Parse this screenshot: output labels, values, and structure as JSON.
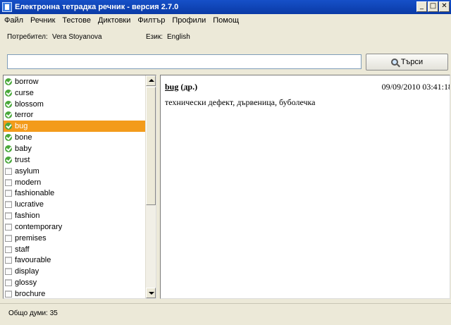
{
  "window": {
    "title": "Електронна тетрадка речник - версия 2.7.0",
    "controls": {
      "minimize": "_",
      "maximize": "□",
      "close": "✕"
    }
  },
  "menu": [
    "Файл",
    "Речник",
    "Тестове",
    "Диктовки",
    "Филтър",
    "Профили",
    "Помощ"
  ],
  "info": {
    "user_label": "Потребител:",
    "user_value": "Vera Stoyanova",
    "lang_label": "Език:",
    "lang_value": "English"
  },
  "search": {
    "value": "",
    "placeholder": "",
    "button_label": "Търси",
    "button_icon": "magnifier-icon"
  },
  "words": [
    {
      "text": "borrow",
      "learned": true
    },
    {
      "text": "curse",
      "learned": true
    },
    {
      "text": "blossom",
      "learned": true
    },
    {
      "text": "terror",
      "learned": true
    },
    {
      "text": "bug",
      "learned": true,
      "selected": true
    },
    {
      "text": "bone",
      "learned": true
    },
    {
      "text": "baby",
      "learned": true
    },
    {
      "text": "trust",
      "learned": true
    },
    {
      "text": "asylum",
      "learned": false
    },
    {
      "text": "modern",
      "learned": false
    },
    {
      "text": "fashionable",
      "learned": false
    },
    {
      "text": "lucrative",
      "learned": false
    },
    {
      "text": "fashion",
      "learned": false
    },
    {
      "text": "contemporary",
      "learned": false
    },
    {
      "text": "premises",
      "learned": false
    },
    {
      "text": "staff",
      "learned": false
    },
    {
      "text": "favourable",
      "learned": false
    },
    {
      "text": "display",
      "learned": false
    },
    {
      "text": "glossy",
      "learned": false
    },
    {
      "text": "brochure",
      "learned": false
    }
  ],
  "detail": {
    "word": "bug",
    "part": "(др.)",
    "date": "09/09/2010 03:41:18",
    "translation": "технически дефект, дървеница, буболечка"
  },
  "status": {
    "text": "Общо думи: 35"
  },
  "colors": {
    "titlebar": "#0a3aa6",
    "selection": "#f39b1b",
    "learned_check": "#4aa83a"
  }
}
